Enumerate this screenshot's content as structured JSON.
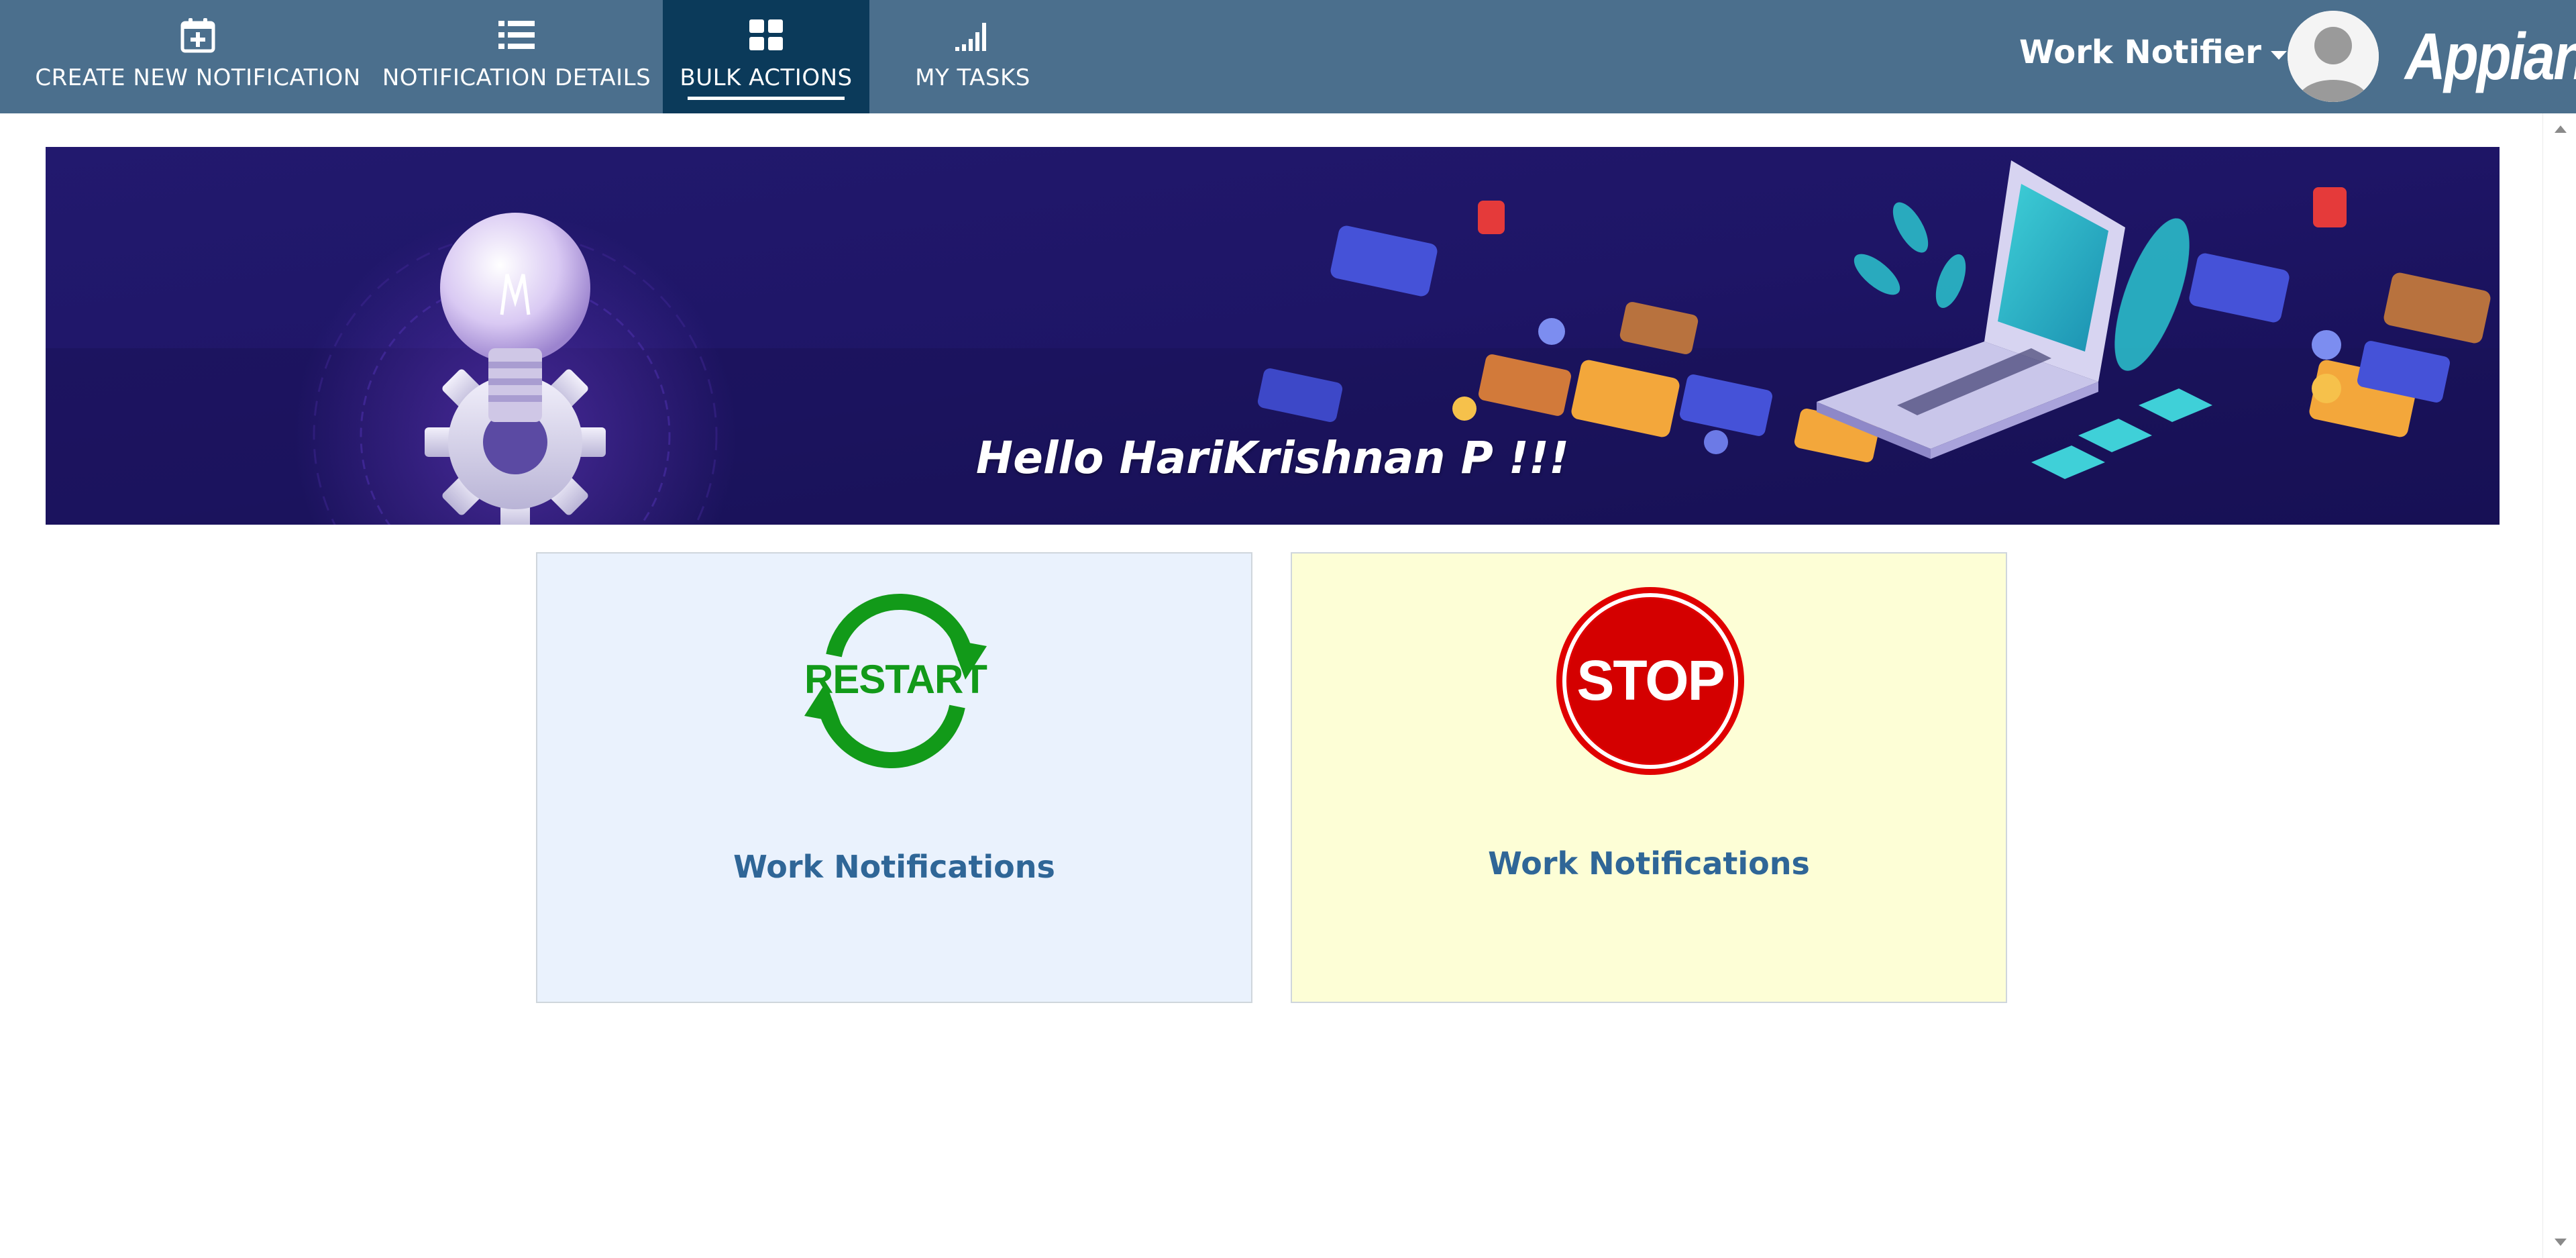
{
  "nav": {
    "tabs": [
      {
        "label": "CREATE NEW NOTIFICATION",
        "icon": "calendar-plus-icon",
        "active": false
      },
      {
        "label": "NOTIFICATION DETAILS",
        "icon": "list-icon",
        "active": false
      },
      {
        "label": "BULK ACTIONS",
        "icon": "grid-icon",
        "active": true
      },
      {
        "label": "MY TASKS",
        "icon": "signal-bars-icon",
        "active": false
      }
    ],
    "site_name": "Work Notifier",
    "brand": "Appian"
  },
  "banner": {
    "greeting": "Hello HariKrishnan P !!!"
  },
  "cards": [
    {
      "badge_text": "RESTART",
      "label": "Work Notifications",
      "icon": "restart-icon"
    },
    {
      "badge_text": "STOP",
      "label": "Work Notifications",
      "icon": "stop-sign-icon"
    }
  ],
  "colors": {
    "header_bg": "#4b6f8d",
    "active_tab_bg": "#0b3a5a",
    "link_text": "#2f6697",
    "restart_green": "#129a19",
    "stop_red": "#e00000",
    "card_blue_bg": "#eaf2fd",
    "card_yellow_bg": "#fdfed6"
  }
}
